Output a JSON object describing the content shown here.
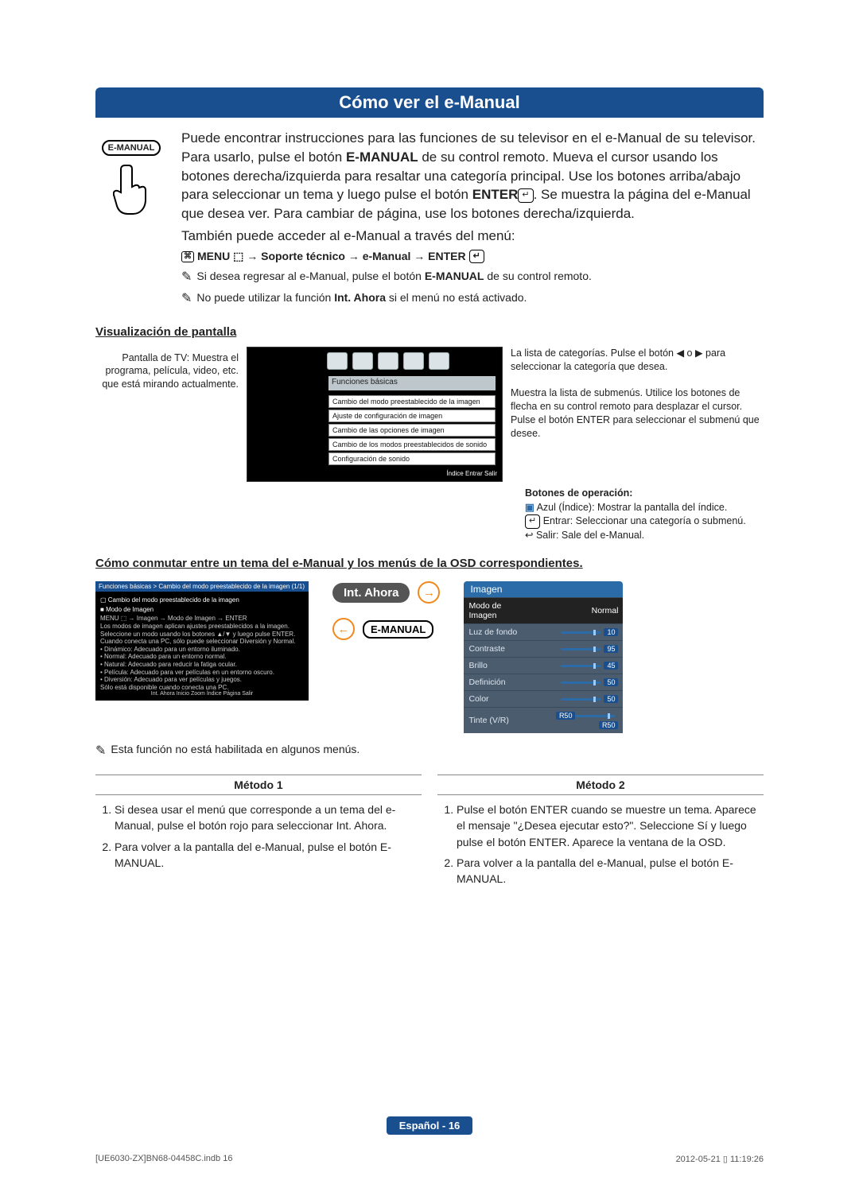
{
  "header": {
    "title": "Cómo ver el e-Manual"
  },
  "intro": {
    "badge": "E-MANUAL",
    "p1a": "Puede encontrar instrucciones para las funciones de su televisor en el e-Manual de su televisor. Para usarlo, pulse el botón ",
    "p1b": "E-MANUAL",
    "p1c": " de su control remoto. Mueva el cursor usando los botones derecha/izquierda para resaltar una categoría principal. Use los botones arriba/abajo para seleccionar un tema y luego pulse el botón ",
    "p1d": "ENTER",
    "p1e": ". Se muestra la página del e-Manual que desea ver. Para cambiar de página, use los botones derecha/izquierda.",
    "p2": "También puede acceder al e-Manual a través del menú:",
    "menu_path": "MENU ⬚ → Soporte técnico → e-Manual → ENTER",
    "note1a": "Si desea regresar al e-Manual, pulse el botón ",
    "note1b": "E-MANUAL",
    "note1c": " de su control remoto.",
    "note2a": "No puede utilizar la función ",
    "note2b": "Int. Ahora",
    "note2c": " si el menú no está activado."
  },
  "vis": {
    "heading": "Visualización de pantalla",
    "left_label": "Pantalla de TV: Muestra el programa, película, video, etc. que está mirando actualmente.",
    "funcbar": "Funciones básicas",
    "items": [
      "Cambio del modo preestablecido de la imagen",
      "Ajuste de configuración de imagen",
      "Cambio de las opciones de imagen",
      "Cambio de los modos preestablecidos de sonido",
      "Configuración de sonido"
    ],
    "tv_foot": "Índice   Entrar   Salir",
    "right1": "La lista de categorías. Pulse el botón ◀ o ▶ para seleccionar la categoría que desea.",
    "right2": "Muestra la lista de submenús. Utilice los botones de flecha en su control remoto para desplazar el cursor. Pulse el botón ENTER para seleccionar el submenú que desee.",
    "botones_title": "Botones de operación:",
    "b1": " Azul (Índice): Mostrar la pantalla del índice.",
    "b2": " Entrar: Seleccionar una categoría o submenú.",
    "b3": " Salir: Sale del e-Manual."
  },
  "swap": {
    "heading": "Cómo conmutar entre un tema del e-Manual y los menús de la OSD correspondientes.",
    "breadcrumb": "Funciones básicas > Cambio del modo preestablecido de la imagen (1/1)",
    "sw_title1": "Cambio del modo preestablecido de la imagen",
    "sw_title2": "Modo de Imagen",
    "sw_path": "MENU ⬚ → Imagen → Modo de Imagen → ENTER",
    "sw_desc": "Los modos de imagen aplican ajustes preestablecidos a la imagen. Seleccione un modo usando los botones ▲/▼ y luego pulse ENTER.",
    "sw_pc": "Cuando conecta una PC, sólo puede seleccionar Diversión y Normal.",
    "sw_bullets": [
      "Dinámico: Adecuado para un entorno iluminado.",
      "Normal: Adecuado para un entorno normal.",
      "Natural: Adecuado para reducir la fatiga ocular.",
      "Película: Adecuado para ver películas en un entorno oscuro.",
      "Diversión: Adecuado para ver películas y juegos."
    ],
    "sw_subnote": "Sólo está disponible cuando conecta una PC.",
    "sw_foot": "Int. Ahora   Inicio   Zoom   Índice   Página   Salir",
    "pill_int": "Int. Ahora",
    "pill_em": "E-MANUAL",
    "osd_head": "Imagen",
    "osd_rows": [
      {
        "label": "Modo de Imagen",
        "value": "Normal",
        "slider": false
      },
      {
        "label": "Luz de fondo",
        "value": "10",
        "slider": true
      },
      {
        "label": "Contraste",
        "value": "95",
        "slider": true
      },
      {
        "label": "Brillo",
        "value": "45",
        "slider": true
      },
      {
        "label": "Definición",
        "value": "50",
        "slider": true
      },
      {
        "label": "Color",
        "value": "50",
        "slider": true
      },
      {
        "label": "Tinte (V/R)",
        "value": "R50",
        "left": "R50",
        "slider": true
      }
    ],
    "note_below": "Esta función no está habilitada en algunos menús."
  },
  "methods": {
    "m1_head": "Método 1",
    "m2_head": "Método 2",
    "m1": [
      "Si desea usar el menú que corresponde a un tema del e-Manual, pulse el botón rojo para seleccionar Int. Ahora.",
      "Para volver a la pantalla del e-Manual, pulse el botón E-MANUAL."
    ],
    "m2": [
      "Pulse el botón ENTER cuando se muestre un tema. Aparece el mensaje \"¿Desea ejecutar esto?\". Seleccione Sí y luego pulse el botón ENTER. Aparece la ventana de la OSD.",
      "Para volver a la pantalla del e-Manual, pulse el botón E-MANUAL."
    ]
  },
  "footer": {
    "page": "Español - 16",
    "file": "[UE6030-ZX]BN68-04458C.indb   16",
    "ts": "2012-05-21   ▯ 11:19:26"
  }
}
